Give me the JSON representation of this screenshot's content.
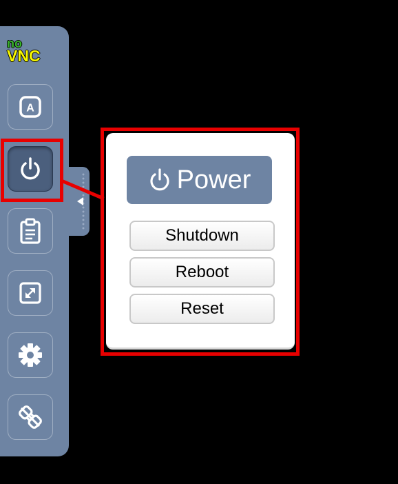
{
  "logo": {
    "no": "no",
    "vnc": "VNC"
  },
  "sidebar": {
    "items": [
      {
        "name": "extra-keys",
        "icon": "keyboard-a-icon"
      },
      {
        "name": "power",
        "icon": "power-icon",
        "active": true
      },
      {
        "name": "clipboard",
        "icon": "clipboard-icon"
      },
      {
        "name": "fullscreen",
        "icon": "fullscreen-icon"
      },
      {
        "name": "settings",
        "icon": "gear-icon"
      },
      {
        "name": "disconnect",
        "icon": "disconnect-icon"
      }
    ],
    "keyboard_glyph": "A"
  },
  "power_panel": {
    "title": "Power",
    "buttons": {
      "shutdown": "Shutdown",
      "reboot": "Reboot",
      "reset": "Reset"
    }
  },
  "colors": {
    "sidebar": "#6e84a3",
    "active_button": "#4b5f7d",
    "highlight": "#e80000",
    "background": "#000000"
  }
}
